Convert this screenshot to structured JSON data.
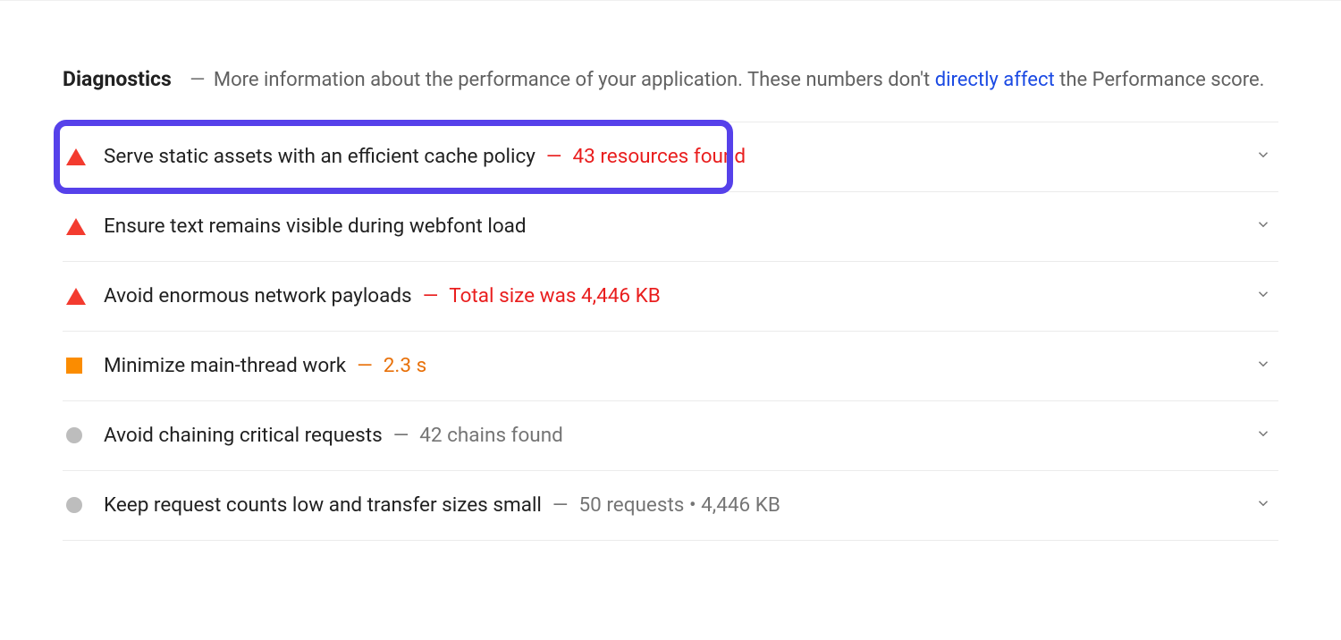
{
  "header": {
    "title": "Diagnostics",
    "dash": "—",
    "description_before": "More information about the performance of your application. These numbers don't ",
    "link_text": "directly affect",
    "description_after": " the Performance score."
  },
  "items": [
    {
      "severity": "red-triangle",
      "title": "Serve static assets with an efficient cache policy",
      "dash": "—",
      "detail": "43 resources found",
      "detail_color": "red",
      "highlighted": true
    },
    {
      "severity": "red-triangle",
      "title": "Ensure text remains visible during webfont load",
      "dash": "",
      "detail": "",
      "detail_color": "",
      "highlighted": false
    },
    {
      "severity": "red-triangle",
      "title": "Avoid enormous network payloads",
      "dash": "—",
      "detail": "Total size was 4,446 KB",
      "detail_color": "red",
      "highlighted": false
    },
    {
      "severity": "orange-square",
      "title": "Minimize main-thread work",
      "dash": "—",
      "detail": "2.3 s",
      "detail_color": "orange",
      "highlighted": false
    },
    {
      "severity": "gray-circle",
      "title": "Avoid chaining critical requests",
      "dash": "—",
      "detail": "42 chains found",
      "detail_color": "gray",
      "highlighted": false
    },
    {
      "severity": "gray-circle",
      "title": "Keep request counts low and transfer sizes small",
      "dash": "—",
      "detail": "50 requests • 4,446 KB",
      "detail_color": "gray",
      "highlighted": false
    }
  ]
}
